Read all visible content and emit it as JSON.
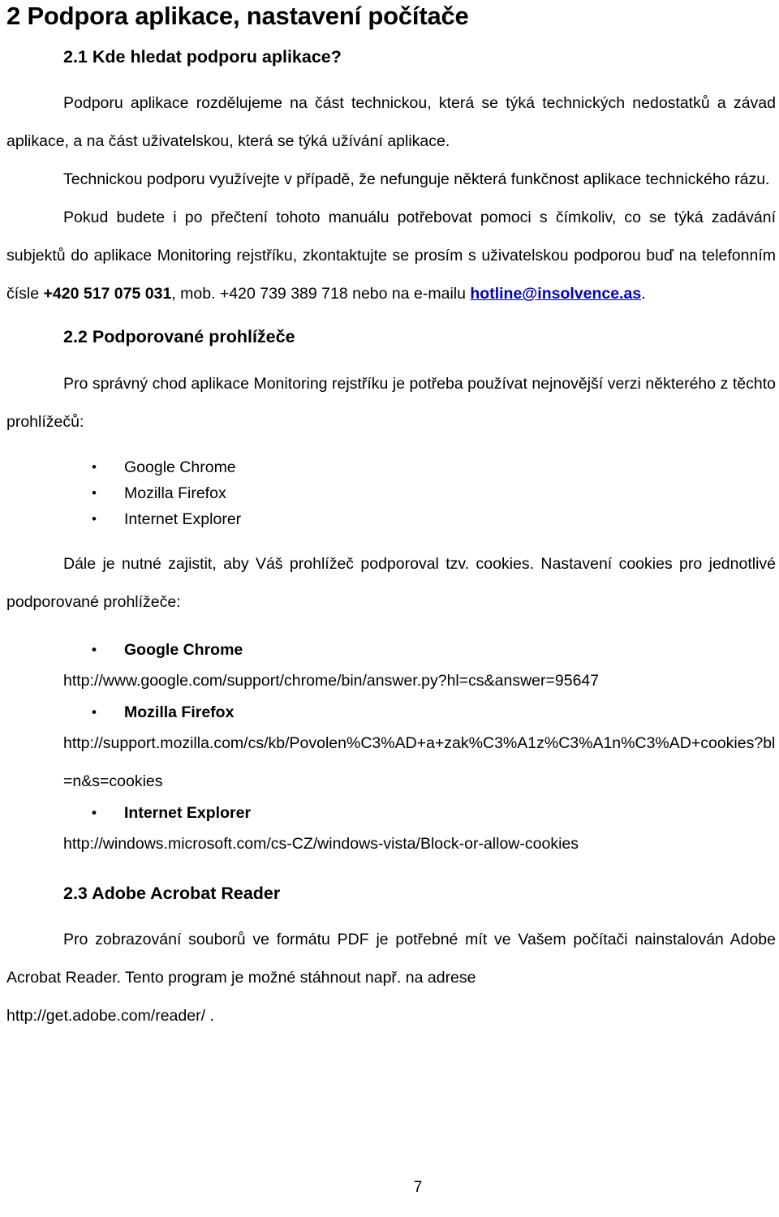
{
  "document": {
    "title": "2 Podpora aplikace, nastavení počítače",
    "page_number": "7",
    "link_color": "#0000C0"
  },
  "section_2_1": {
    "heading": "2.1 Kde hledat podporu aplikace?",
    "paragraph_1": "Podporu aplikace rozdělujeme na část technickou, která se týká technických nedostatků a závad aplikace, a na část uživatelskou, která se týká užívání aplikace.",
    "paragraph_2": "Technickou podporu využívejte v případě, že nefunguje některá funkčnost aplikace technického rázu.",
    "contact_paragraph": {
      "part_1": "Pokud budete i po přečtení tohoto manuálu potřebovat pomoci s čímkoliv, co se týká zadávání subjektů do aplikace Monitoring rejstříku, zkontaktujte se prosím s uživatelskou podporou buď na telefonním čísle ",
      "phone_landline": "+420 517 075 031",
      "part_2": ", mob. ",
      "phone_mobile": "+420 739 389 718",
      "part_3": " nebo na e-mailu ",
      "email": "hotline@insolvence.as",
      "part_4": "."
    }
  },
  "section_2_2": {
    "heading": "2.2 Podporované prohlížeče",
    "paragraph_1": "Pro správný chod aplikace Monitoring rejstříku je potřeba používat nejnovější verzi některého z těchto prohlížečů:",
    "browser_list": [
      "Google Chrome",
      "Mozilla Firefox",
      "Internet Explorer"
    ],
    "paragraph_2": "Dále je nutné zajistit, aby Váš prohlížeč podporoval tzv. cookies. Nastavení cookies pro jednotlivé podporované prohlížeče:",
    "cookie_settings": [
      {
        "browser": "Google Chrome",
        "url": "http://www.google.com/support/chrome/bin/answer.py?hl=cs&answer=95647"
      },
      {
        "browser": "Mozilla Firefox",
        "url": "http://support.mozilla.com/cs/kb/Povolen%C3%AD+a+zak%C3%A1z%C3%A1n%C3%AD+cookies?bl=n&s=cookies"
      },
      {
        "browser": "Internet Explorer",
        "url": "http://windows.microsoft.com/cs-CZ/windows-vista/Block-or-allow-cookies"
      }
    ]
  },
  "section_2_3": {
    "heading": "2.3 Adobe Acrobat Reader",
    "paragraph_1": "Pro zobrazování souborů ve formátu PDF je potřebné mít ve Vašem počítači nainstalován Adobe Acrobat Reader. Tento program je možné stáhnout např. na adrese",
    "download_url": "http://get.adobe.com/reader/ ."
  }
}
